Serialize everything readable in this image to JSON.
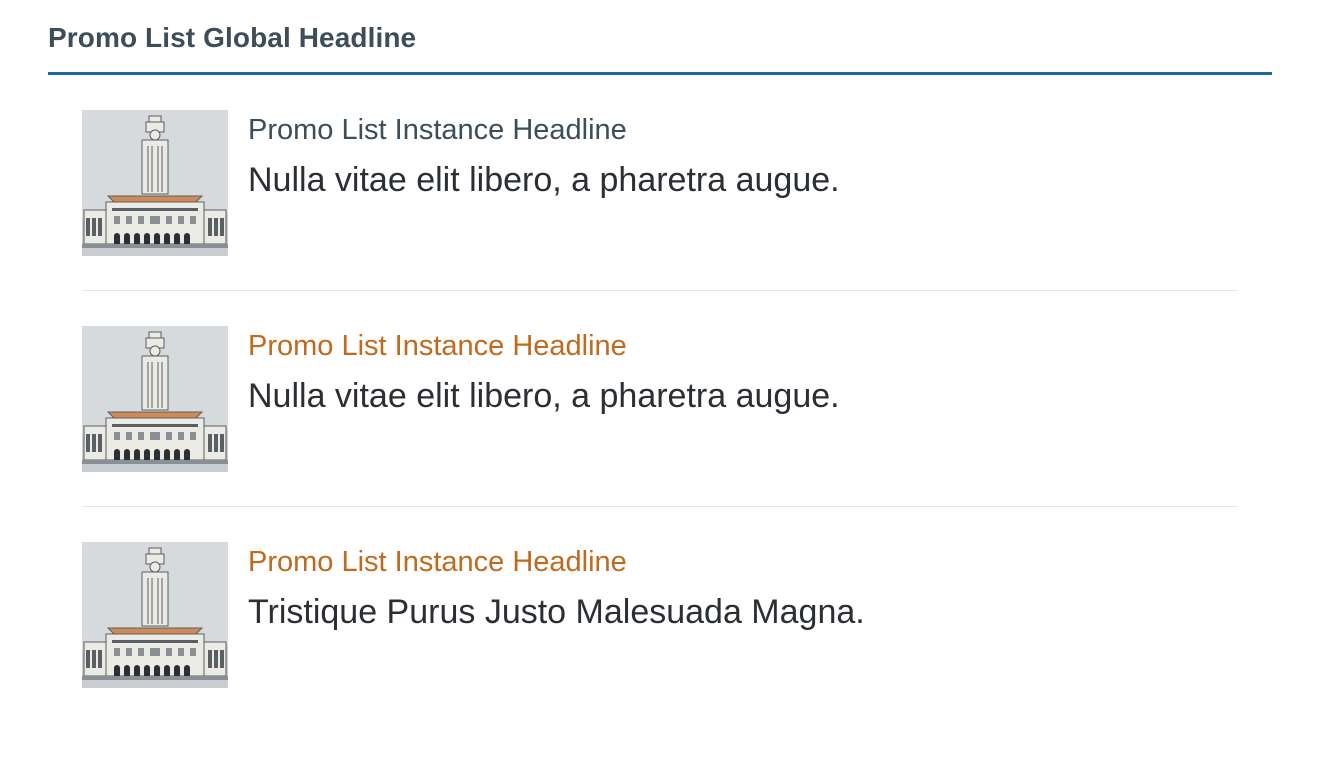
{
  "promo": {
    "global_headline": "Promo List Global Headline",
    "colors": {
      "rule": "#1f6a99",
      "headline_default": "#3d4d59",
      "headline_accent": "#c06a1e",
      "body_text": "#2b2f33",
      "thumbnail_bg": "#d7dadd"
    },
    "items": [
      {
        "image": "tower-illustration",
        "headline": "Promo List Instance Headline",
        "headline_color": "default",
        "description": "Nulla vitae elit libero, a pharetra augue."
      },
      {
        "image": "tower-illustration",
        "headline": "Promo List Instance Headline",
        "headline_color": "accent",
        "description": "Nulla vitae elit libero, a pharetra augue."
      },
      {
        "image": "tower-illustration",
        "headline": "Promo List Instance Headline",
        "headline_color": "accent",
        "description": "Tristique Purus Justo Malesuada Magna."
      }
    ]
  }
}
